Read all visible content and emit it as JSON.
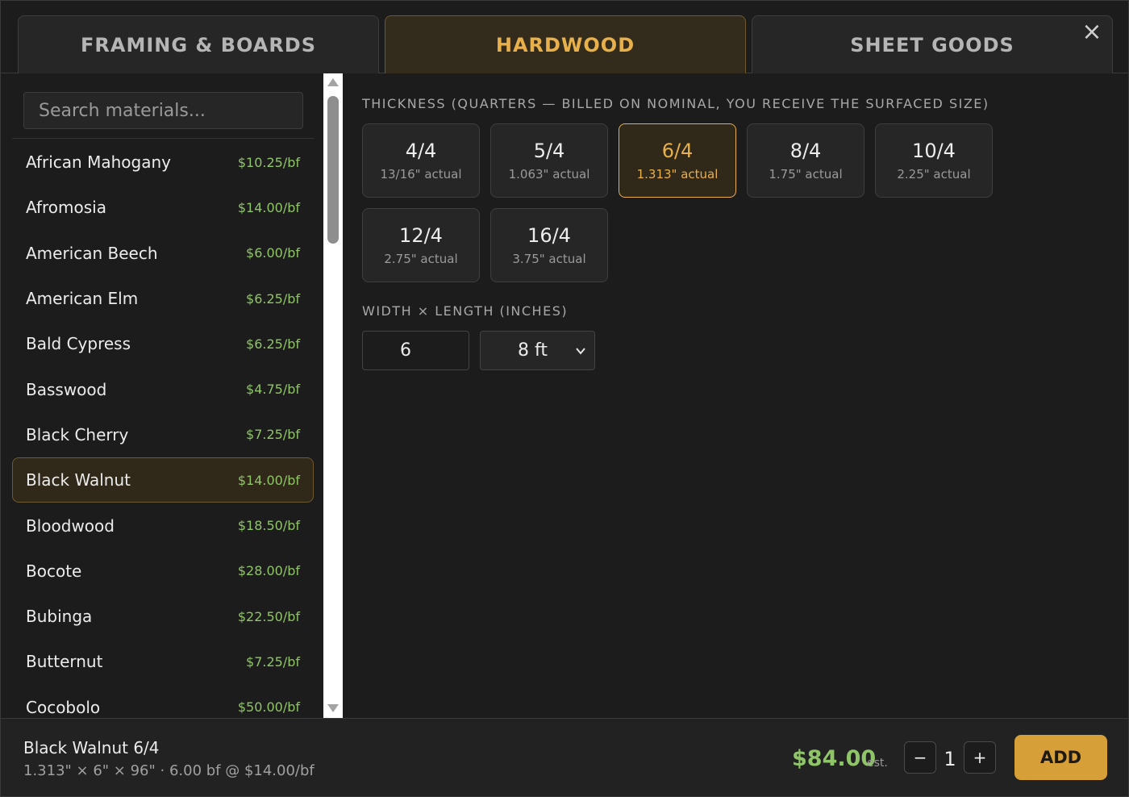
{
  "tabs": [
    {
      "label": "FRAMING & BOARDS"
    },
    {
      "label": "HARDWOOD"
    },
    {
      "label": "SHEET GOODS"
    }
  ],
  "close_icon": "×",
  "search": {
    "placeholder": "Search materials..."
  },
  "materials": [
    {
      "name": "African Mahogany",
      "price": "$10.25/bf"
    },
    {
      "name": "Afromosia",
      "price": "$14.00/bf"
    },
    {
      "name": "American Beech",
      "price": "$6.00/bf"
    },
    {
      "name": "American Elm",
      "price": "$6.25/bf"
    },
    {
      "name": "Bald Cypress",
      "price": "$6.25/bf"
    },
    {
      "name": "Basswood",
      "price": "$4.75/bf"
    },
    {
      "name": "Black Cherry",
      "price": "$7.25/bf"
    },
    {
      "name": "Black Walnut",
      "price": "$14.00/bf"
    },
    {
      "name": "Bloodwood",
      "price": "$18.50/bf"
    },
    {
      "name": "Bocote",
      "price": "$28.00/bf"
    },
    {
      "name": "Bubinga",
      "price": "$22.50/bf"
    },
    {
      "name": "Butternut",
      "price": "$7.25/bf"
    },
    {
      "name": "Cocobolo",
      "price": "$50.00/bf"
    }
  ],
  "selected_material": "Black Walnut",
  "thickness": {
    "label": "THICKNESS (QUARTERS — BILLED ON NOMINAL, YOU RECEIVE THE SURFACED SIZE)",
    "options": [
      {
        "nominal": "4/4",
        "actual": "13/16\" actual"
      },
      {
        "nominal": "5/4",
        "actual": "1.063\" actual"
      },
      {
        "nominal": "6/4",
        "actual": "1.313\" actual"
      },
      {
        "nominal": "8/4",
        "actual": "1.75\" actual"
      },
      {
        "nominal": "10/4",
        "actual": "2.25\" actual"
      },
      {
        "nominal": "12/4",
        "actual": "2.75\" actual"
      },
      {
        "nominal": "16/4",
        "actual": "3.75\" actual"
      }
    ],
    "selected": "6/4"
  },
  "dimensions": {
    "label": "WIDTH × LENGTH (INCHES)",
    "width": "6",
    "length": "8 ft"
  },
  "footer": {
    "title": "Black Walnut 6/4",
    "detail": "1.313\" × 6\" × 96\" · 6.00 bf @ $14.00/bf",
    "price": "$84.00",
    "est_label": "est.",
    "minus": "−",
    "plus": "+",
    "quantity": "1",
    "add_label": "ADD"
  },
  "colors": {
    "accent": "#e7b04a",
    "price_green": "#8fc468",
    "add_button": "#d69f38"
  }
}
